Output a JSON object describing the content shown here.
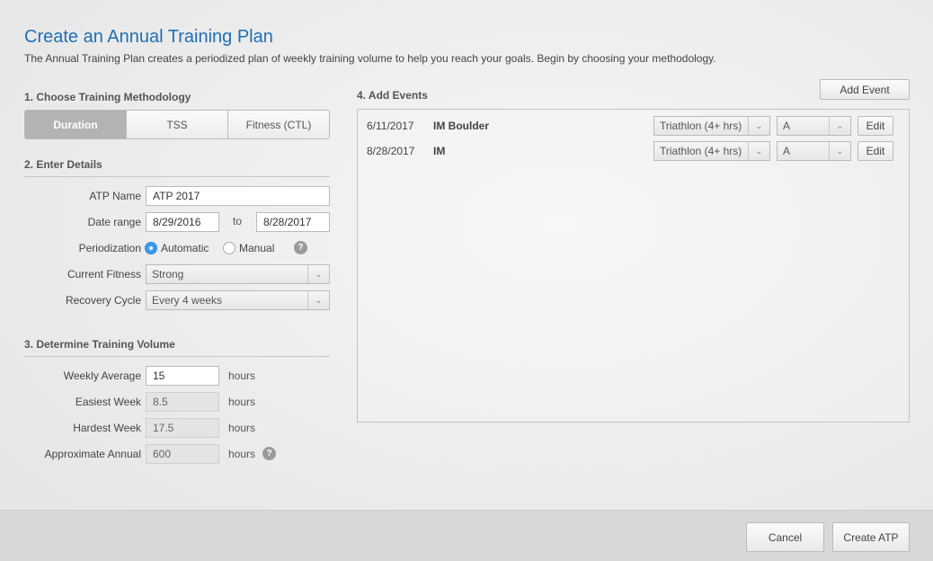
{
  "header": {
    "title": "Create an Annual Training Plan",
    "subtitle": "The Annual Training Plan creates a periodized plan of weekly training volume to help you reach your goals. Begin by choosing your methodology."
  },
  "methodology": {
    "heading": "1. Choose Training Methodology",
    "options": [
      "Duration",
      "TSS",
      "Fitness (CTL)"
    ],
    "selected": "Duration"
  },
  "details": {
    "heading": "2. Enter Details",
    "atp_name_label": "ATP Name",
    "atp_name_value": "ATP 2017",
    "date_range_label": "Date range",
    "date_start": "8/29/2016",
    "date_to": "to",
    "date_end": "8/28/2017",
    "periodization_label": "Periodization",
    "periodization_auto": "Automatic",
    "periodization_manual": "Manual",
    "periodization_selected": "Automatic",
    "help_glyph": "?",
    "fitness_label": "Current Fitness",
    "fitness_value": "Strong",
    "recovery_label": "Recovery Cycle",
    "recovery_value": "Every 4 weeks"
  },
  "volume": {
    "heading": "3. Determine Training Volume",
    "unit": "hours",
    "weekly_label": "Weekly Average",
    "weekly_value": "15",
    "easiest_label": "Easiest Week",
    "easiest_value": "8.5",
    "hardest_label": "Hardest Week",
    "hardest_value": "17.5",
    "annual_label": "Approximate Annual",
    "annual_value": "600"
  },
  "events": {
    "heading": "4. Add Events",
    "add_button": "Add Event",
    "edit_label": "Edit",
    "rows": [
      {
        "date": "6/11/2017",
        "name": "IM Boulder",
        "type": "Triathlon (4+ hrs)",
        "priority": "A"
      },
      {
        "date": "8/28/2017",
        "name": "IM",
        "type": "Triathlon (4+ hrs)",
        "priority": "A"
      }
    ]
  },
  "footer": {
    "cancel": "Cancel",
    "create": "Create ATP"
  },
  "colors": {
    "accent": "#1f6fb5",
    "radio_on": "#3b99f0",
    "segment_active": "#b3b3b3"
  }
}
